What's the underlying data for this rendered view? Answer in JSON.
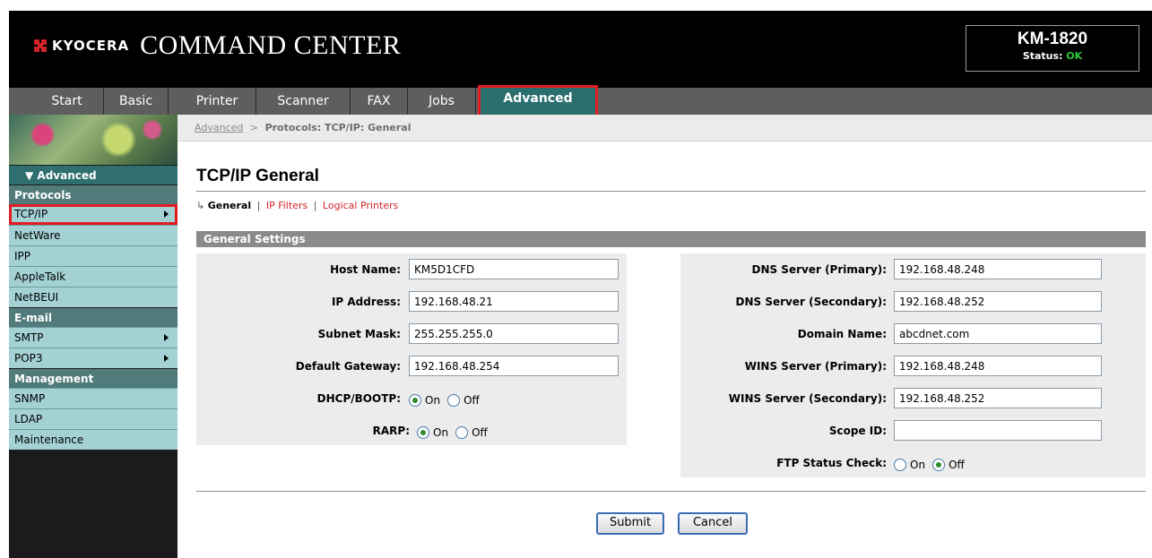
{
  "header": {
    "brand": "KYOCERA",
    "product": "COMMAND CENTER",
    "model": "KM-1820",
    "status_label": "Status:",
    "status_value": "OK"
  },
  "tabs": [
    {
      "label": "Start"
    },
    {
      "label": "Basic"
    },
    {
      "label": "Printer"
    },
    {
      "label": "Scanner"
    },
    {
      "label": "FAX"
    },
    {
      "label": "Jobs"
    },
    {
      "label": "Advanced",
      "active": true
    }
  ],
  "sidebar": {
    "section_head": "Advanced",
    "groups": [
      {
        "label": "Protocols",
        "items": [
          {
            "label": "TCP/IP",
            "arrow": true,
            "selected": true
          },
          {
            "label": "NetWare"
          },
          {
            "label": "IPP"
          },
          {
            "label": "AppleTalk"
          },
          {
            "label": "NetBEUI"
          }
        ]
      },
      {
        "label": "E-mail",
        "items": [
          {
            "label": "SMTP",
            "arrow": true
          },
          {
            "label": "POP3",
            "arrow": true
          }
        ]
      },
      {
        "label": "Management",
        "items": [
          {
            "label": "SNMP"
          },
          {
            "label": "LDAP"
          },
          {
            "label": "Maintenance"
          }
        ]
      }
    ]
  },
  "breadcrumb": {
    "link": "Advanced",
    "separator": ">",
    "current": "Protocols: TCP/IP: General"
  },
  "page": {
    "title": "TCP/IP General",
    "subnav": {
      "current": "General",
      "separator": "|",
      "links": [
        "IP Filters",
        "Logical Printers"
      ]
    },
    "settings_header": "General Settings"
  },
  "form": {
    "left": {
      "host_name": {
        "label": "Host Name:",
        "value": "KM5D1CFD"
      },
      "ip_address": {
        "label": "IP Address:",
        "value": "192.168.48.21"
      },
      "subnet_mask": {
        "label": "Subnet Mask:",
        "value": "255.255.255.0"
      },
      "default_gateway": {
        "label": "Default Gateway:",
        "value": "192.168.48.254"
      },
      "dhcp_bootp": {
        "label": "DHCP/BOOTP:",
        "selected": "On"
      },
      "rarp": {
        "label": "RARP:",
        "selected": "On"
      }
    },
    "right": {
      "dns_primary": {
        "label": "DNS Server (Primary):",
        "value": "192.168.48.248"
      },
      "dns_secondary": {
        "label": "DNS Server (Secondary):",
        "value": "192.168.48.252"
      },
      "domain_name": {
        "label": "Domain Name:",
        "value": "abcdnet.com"
      },
      "wins_primary": {
        "label": "WINS Server (Primary):",
        "value": "192.168.48.248"
      },
      "wins_secondary": {
        "label": "WINS Server (Secondary):",
        "value": "192.168.48.252"
      },
      "scope_id": {
        "label": "Scope ID:",
        "value": ""
      },
      "ftp_status_check": {
        "label": "FTP Status Check:",
        "selected": "Off"
      }
    },
    "option_on": "On",
    "option_off": "Off"
  },
  "buttons": {
    "submit": "Submit",
    "cancel": "Cancel"
  },
  "colors": {
    "active_tab": "#2b6e6e",
    "highlight": "#e31c23",
    "sidebar_item": "#a4d1d4",
    "status_ok": "#2ec93c",
    "link_red": "#d0252b"
  }
}
